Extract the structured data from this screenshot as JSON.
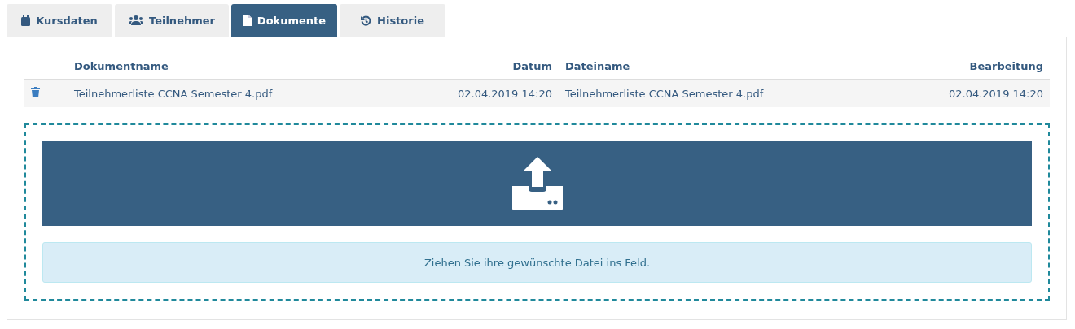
{
  "tabs": [
    {
      "label": "Kursdaten",
      "kind": "calendar",
      "selected": false
    },
    {
      "label": "Teilnehmer",
      "kind": "users",
      "selected": false
    },
    {
      "label": "Dokumente",
      "kind": "file",
      "selected": true
    },
    {
      "label": "Historie",
      "kind": "history",
      "selected": false
    }
  ],
  "table": {
    "columns": [
      "Dokumentname",
      "Datum",
      "Dateiname",
      "Bearbeitung"
    ],
    "rows": [
      {
        "cells": [
          "Teilnehmerliste CCNA Semester 4.pdf",
          "02.04.2019 14:20",
          "Teilnehmerliste CCNA Semester 4.pdf",
          "02.04.2019 14:20"
        ]
      }
    ]
  },
  "dropzone": {
    "hint": "Ziehen Sie ihre gewünschte Datei ins Feld."
  }
}
